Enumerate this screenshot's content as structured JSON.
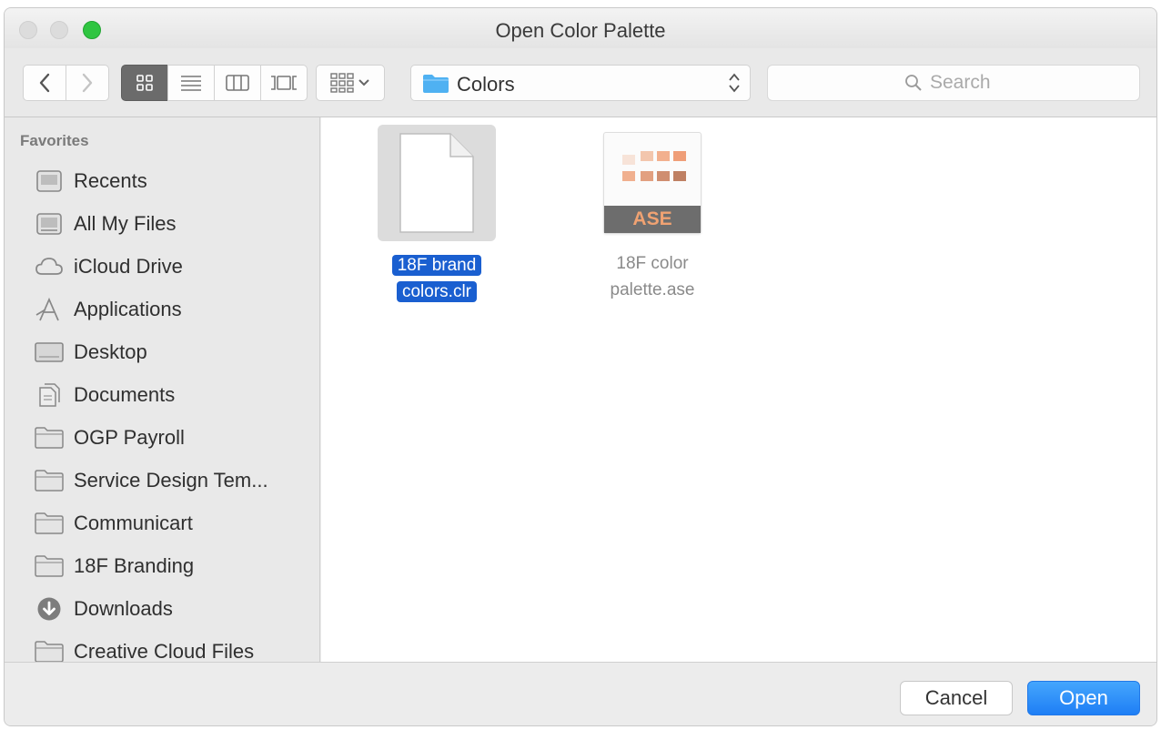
{
  "window": {
    "title": "Open Color Palette"
  },
  "toolbar": {
    "location": "Colors",
    "search_placeholder": "Search"
  },
  "sidebar": {
    "heading": "Favorites",
    "items": [
      {
        "label": "Recents",
        "icon": "recents-icon"
      },
      {
        "label": "All My Files",
        "icon": "all-files-icon"
      },
      {
        "label": "iCloud Drive",
        "icon": "cloud-icon"
      },
      {
        "label": "Applications",
        "icon": "applications-icon"
      },
      {
        "label": "Desktop",
        "icon": "desktop-icon"
      },
      {
        "label": "Documents",
        "icon": "documents-icon"
      },
      {
        "label": "OGP Payroll",
        "icon": "folder-icon"
      },
      {
        "label": "Service Design Tem...",
        "icon": "folder-icon"
      },
      {
        "label": "Communicart",
        "icon": "folder-icon"
      },
      {
        "label": "18F Branding",
        "icon": "folder-icon"
      },
      {
        "label": "Downloads",
        "icon": "downloads-icon"
      },
      {
        "label": "Creative Cloud Files",
        "icon": "folder-icon"
      }
    ]
  },
  "files": [
    {
      "line1": "18F brand",
      "line2": "colors.clr",
      "selected": true
    },
    {
      "line1": "18F color",
      "line2": "palette.ase",
      "badge": "ASE",
      "selected": false
    }
  ],
  "footer": {
    "cancel_label": "Cancel",
    "open_label": "Open"
  },
  "colors": {
    "selection": "#1a5fd0",
    "primary_button": "#1e7ef5",
    "ase_accent": "#f0a272"
  }
}
